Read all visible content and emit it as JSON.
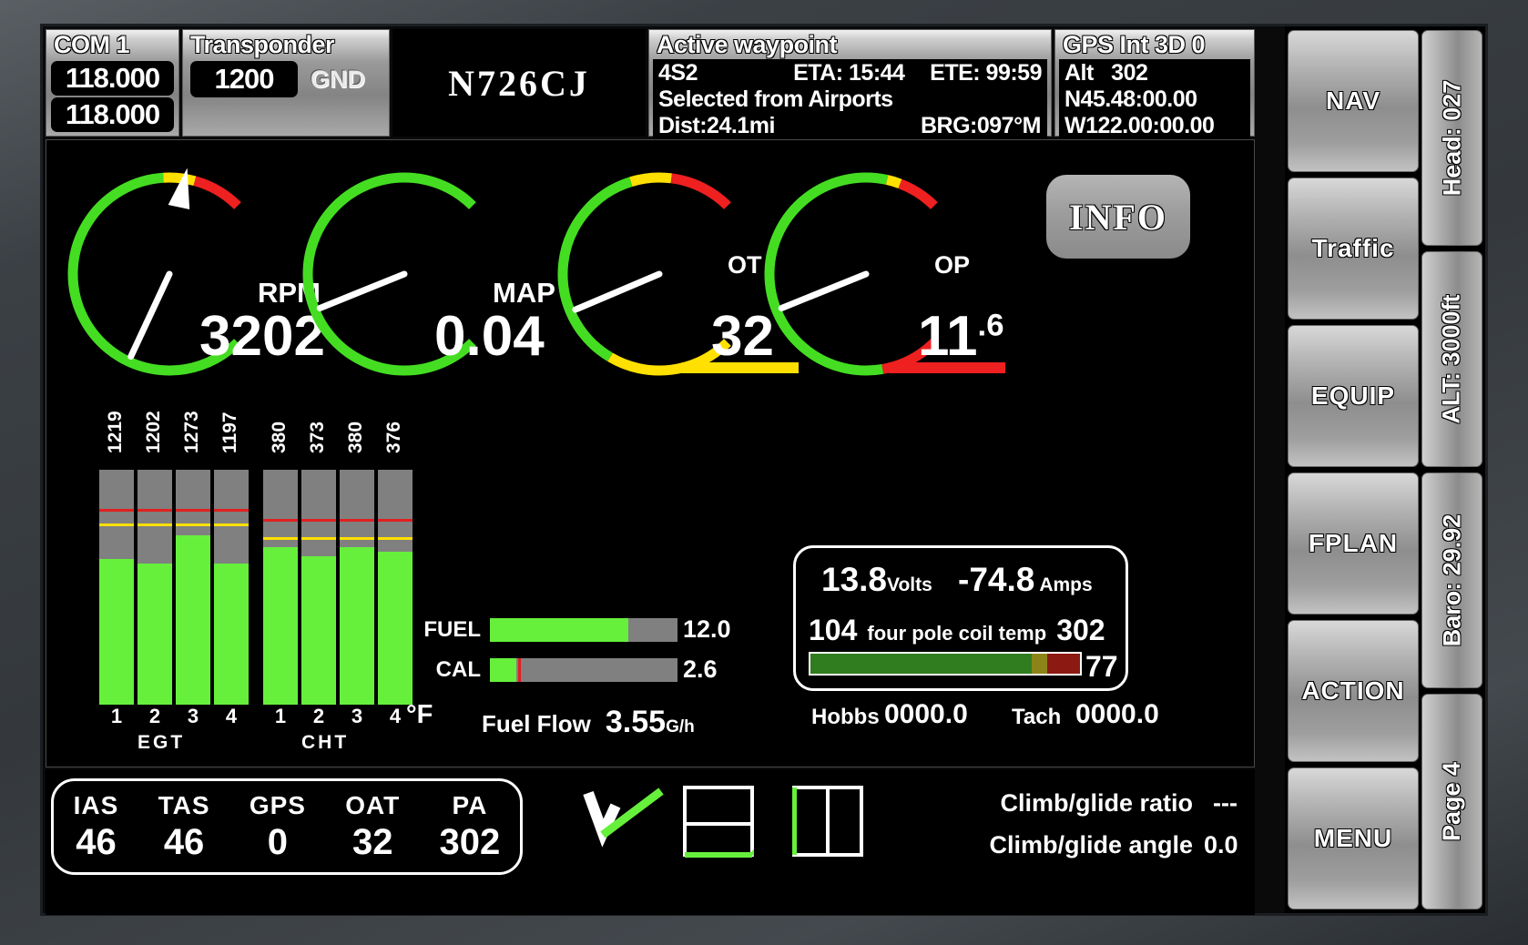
{
  "com": {
    "title": "COM 1",
    "active": "118.000",
    "standby": "118.000"
  },
  "transponder": {
    "title": "Transponder",
    "code": "1200",
    "mode": "GND"
  },
  "tail_number": "N726CJ",
  "waypoint": {
    "title": "Active waypoint",
    "id": "4S2",
    "eta": "ETA: 15:44",
    "ete": "ETE: 99:59",
    "source": "Selected from Airports",
    "dist": "Dist:24.1mi",
    "brg": "BRG:097°M"
  },
  "gps": {
    "title": "GPS  Int 3D 0",
    "alt_label": "Alt",
    "alt_value": "302",
    "lat": "N45.48:00.00",
    "lon": "W122.00:00.00"
  },
  "info_button": "INFO",
  "gauges": [
    {
      "name": "rpm",
      "label": "RPM",
      "value": "3202",
      "needle_deg": 205,
      "arcs": [
        {
          "color": "#44dd22",
          "from": 0,
          "to": 82
        },
        {
          "color": "#ffe000",
          "from": 82,
          "to": 89
        },
        {
          "color": "#ee2020",
          "from": 89,
          "to": 100
        }
      ],
      "marker": true,
      "underbar": null
    },
    {
      "name": "map",
      "label": "MAP",
      "value": "0.04",
      "needle_deg": 248,
      "arcs": [
        {
          "color": "#44dd22",
          "from": 0,
          "to": 100
        }
      ],
      "marker": false,
      "underbar": null
    },
    {
      "name": "ot",
      "label": "OT",
      "value": "32",
      "needle_deg": 247,
      "arcs": [
        {
          "color": "#ffe000",
          "from": 0,
          "to": 28
        },
        {
          "color": "#44dd22",
          "from": 28,
          "to": 77
        },
        {
          "color": "#ffe000",
          "from": 77,
          "to": 86
        },
        {
          "color": "#ee2020",
          "from": 86,
          "to": 100
        }
      ],
      "marker": false,
      "underbar": "#ffe000"
    },
    {
      "name": "op",
      "label": "OP",
      "value": "11",
      "value_sup": ".6",
      "needle_deg": 248,
      "arcs": [
        {
          "color": "#ee2020",
          "from": 0,
          "to": 13
        },
        {
          "color": "#44dd22",
          "from": 13,
          "to": 88
        },
        {
          "color": "#ffe000",
          "from": 88,
          "to": 91
        },
        {
          "color": "#ee2020",
          "from": 91,
          "to": 100
        }
      ],
      "marker": false,
      "underbar": "#ee2020"
    }
  ],
  "chart_data": [
    {
      "type": "bar",
      "title": "EGT",
      "categories": [
        "1",
        "2",
        "3",
        "4"
      ],
      "values": [
        1219,
        1202,
        1273,
        1197
      ],
      "value_labels": [
        "1219",
        "1202",
        "1273",
        "1197"
      ],
      "unit": "°F",
      "fill_pct": [
        62,
        60,
        72,
        60
      ],
      "yellow_line_pct": 76,
      "red_line_pct": 82,
      "bar_color": "#66f03c",
      "track_color": "#808080",
      "grid": false,
      "axis_label": "EGT"
    },
    {
      "type": "bar",
      "title": "CHT",
      "categories": [
        "1",
        "2",
        "3",
        "4"
      ],
      "values": [
        380,
        373,
        380,
        376
      ],
      "value_labels": [
        "380",
        "373",
        "380",
        "376"
      ],
      "unit": "°F",
      "fill_pct": [
        67,
        63,
        67,
        65
      ],
      "yellow_line_pct": 70,
      "red_line_pct": 78,
      "bar_color": "#66f03c",
      "track_color": "#808080",
      "grid": false,
      "axis_label": "CHT"
    }
  ],
  "temp_unit": "°F",
  "level_bars": [
    {
      "label": "FUEL",
      "value": "12.0",
      "fill_pct": 74,
      "marker_pct": null
    },
    {
      "label": "CAL",
      "value": "2.6",
      "fill_pct": 14,
      "marker_pct": 15
    }
  ],
  "fuel_flow": {
    "label": "Fuel Flow",
    "value": "3.55",
    "unit": "G/h"
  },
  "electrical": {
    "volts_value": "13.8",
    "volts_unit": "Volts",
    "amps_value": "-74.8",
    "amps_unit": "Amps",
    "coil_left": "104",
    "coil_label": "four pole coil temp",
    "coil_right": "302",
    "coil_side": "77",
    "coil_green_pct": 82,
    "coil_yellow_pct": 6,
    "coil_red_pct": 12,
    "coil_green": "#2f7d1f",
    "coil_yellow": "#8d8418",
    "coil_red": "#8d1a12"
  },
  "runtime": {
    "hobbs_label": "Hobbs",
    "hobbs_value": "0000.0",
    "tach_label": "Tach",
    "tach_value": "0000.0"
  },
  "air_data": [
    {
      "label": "IAS",
      "value": "46"
    },
    {
      "label": "TAS",
      "value": "46"
    },
    {
      "label": "GPS",
      "value": "0"
    },
    {
      "label": "OAT",
      "value": "32"
    },
    {
      "label": "PA",
      "value": "302"
    }
  ],
  "climb": {
    "ratio_label": "Climb/glide ratio",
    "ratio_value": "---",
    "angle_label": "Climb/glide angle",
    "angle_value": "0.0"
  },
  "rail_buttons": [
    "NAV",
    "Traffic",
    "EQUIP",
    "FPLAN",
    "ACTION",
    "MENU"
  ],
  "rail_info": [
    "Head: 027",
    "ALT: 3000ft",
    "Baro: 29.92",
    "Page 4"
  ],
  "colors": {
    "green": "#66f03c",
    "arc_green": "#44dd22",
    "yellow": "#ffe000",
    "red": "#ee2020",
    "gray_track": "#808080"
  }
}
